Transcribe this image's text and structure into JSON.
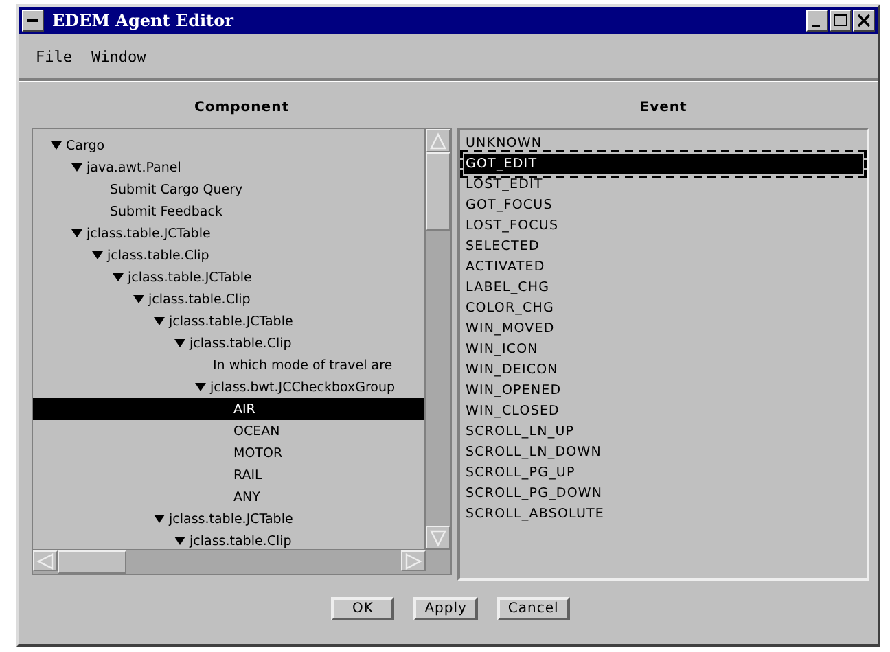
{
  "window": {
    "title": "EDEM Agent Editor"
  },
  "menu": [
    "File",
    "Window"
  ],
  "component_heading": "Component",
  "event_heading": "Event",
  "tree": [
    {
      "label": "Cargo",
      "expanded": true,
      "selected": false,
      "children": [
        {
          "label": "java.awt.Panel",
          "expanded": true,
          "selected": false,
          "children": [
            {
              "label": "Submit Cargo Query",
              "selected": false
            },
            {
              "label": "Submit Feedback",
              "selected": false
            }
          ]
        },
        {
          "label": "jclass.table.JCTable",
          "expanded": true,
          "selected": false,
          "children": [
            {
              "label": "jclass.table.Clip",
              "expanded": true,
              "selected": false,
              "children": [
                {
                  "label": "jclass.table.JCTable",
                  "expanded": true,
                  "selected": false,
                  "children": [
                    {
                      "label": "jclass.table.Clip",
                      "expanded": true,
                      "selected": false,
                      "children": [
                        {
                          "label": "jclass.table.JCTable",
                          "expanded": true,
                          "selected": false,
                          "children": [
                            {
                              "label": "jclass.table.Clip",
                              "expanded": true,
                              "selected": false,
                              "children": [
                                {
                                  "label": "In which mode of travel are",
                                  "selected": false
                                },
                                {
                                  "label": "jclass.bwt.JCCheckboxGroup",
                                  "expanded": true,
                                  "selected": false,
                                  "children": [
                                    {
                                      "label": "AIR",
                                      "selected": true
                                    },
                                    {
                                      "label": "OCEAN",
                                      "selected": false
                                    },
                                    {
                                      "label": "MOTOR",
                                      "selected": false
                                    },
                                    {
                                      "label": "RAIL",
                                      "selected": false
                                    },
                                    {
                                      "label": "ANY",
                                      "selected": false
                                    }
                                  ]
                                }
                              ]
                            }
                          ]
                        },
                        {
                          "label": "jclass.table.JCTable",
                          "expanded": true,
                          "selected": false,
                          "children": [
                            {
                              "label": "jclass.table.Clip",
                              "expanded": true,
                              "selected": false
                            }
                          ]
                        }
                      ]
                    }
                  ]
                }
              ]
            }
          ]
        }
      ]
    }
  ],
  "events": [
    {
      "label": "UNKNOWN",
      "selected": false
    },
    {
      "label": "GOT_EDIT",
      "selected": true
    },
    {
      "label": "LOST_EDIT",
      "selected": false
    },
    {
      "label": "GOT_FOCUS",
      "selected": false
    },
    {
      "label": "LOST_FOCUS",
      "selected": false
    },
    {
      "label": "SELECTED",
      "selected": false
    },
    {
      "label": "ACTIVATED",
      "selected": false
    },
    {
      "label": "LABEL_CHG",
      "selected": false
    },
    {
      "label": "COLOR_CHG",
      "selected": false
    },
    {
      "label": "WIN_MOVED",
      "selected": false
    },
    {
      "label": "WIN_ICON",
      "selected": false
    },
    {
      "label": "WIN_DEICON",
      "selected": false
    },
    {
      "label": "WIN_OPENED",
      "selected": false
    },
    {
      "label": "WIN_CLOSED",
      "selected": false
    },
    {
      "label": "SCROLL_LN_UP",
      "selected": false
    },
    {
      "label": "SCROLL_LN_DOWN",
      "selected": false
    },
    {
      "label": "SCROLL_PG_UP",
      "selected": false
    },
    {
      "label": "SCROLL_PG_DOWN",
      "selected": false
    },
    {
      "label": "SCROLL_ABSOLUTE",
      "selected": false
    }
  ],
  "buttons": [
    "OK",
    "Apply",
    "Cancel"
  ]
}
